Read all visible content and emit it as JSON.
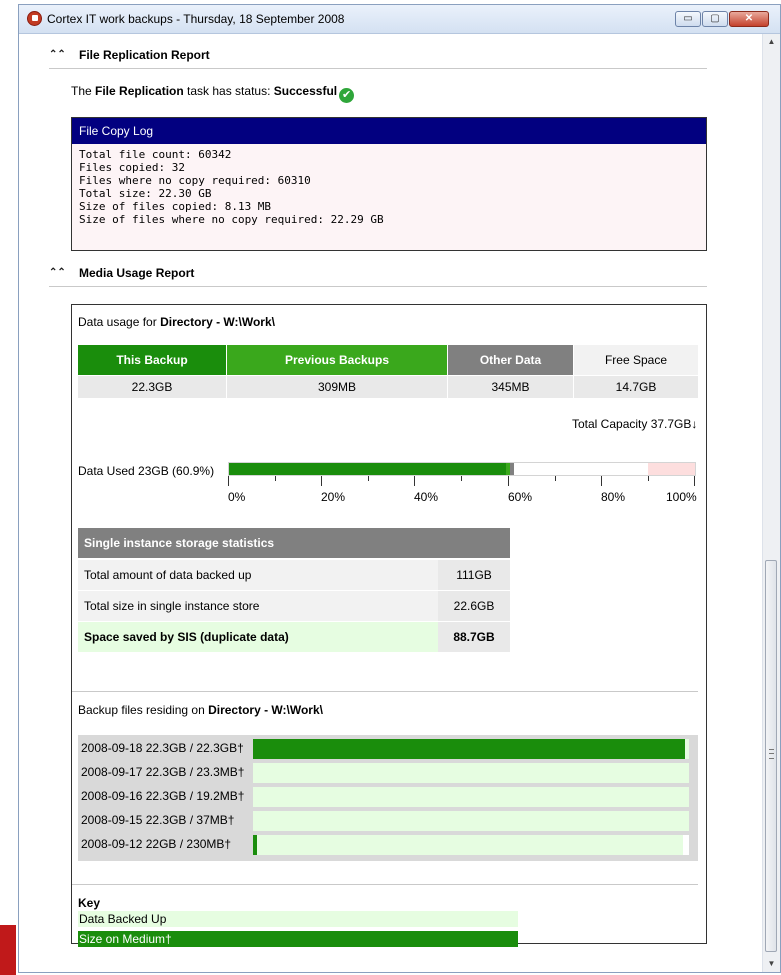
{
  "window": {
    "title": "Cortex IT work backups - Thursday, 18 September 2008",
    "icon": "cortex-app-icon",
    "buttons": {
      "minimize": "▭",
      "maximize": "▢",
      "close": "✕"
    }
  },
  "file_replication": {
    "section_title": "File Replication Report",
    "status_prefix": "The ",
    "task_name": "File Replication",
    "status_middle": " task has status: ",
    "status_value": "Successful",
    "log_title": "File Copy Log",
    "log_lines": [
      "Total file count: 60342",
      "Files copied: 32",
      "Files where no copy required: 60310",
      "Total size: 22.30 GB",
      "Size of files copied: 8.13 MB",
      "Size of files where no copy required: 22.29 GB"
    ]
  },
  "media_usage": {
    "section_title": "Media Usage Report",
    "data_usage_prefix": "Data usage for ",
    "directory_label": "Directory - W:\\Work\\",
    "usage_headers": [
      "This Backup",
      "Previous Backups",
      "Other Data",
      "Free Space"
    ],
    "usage_values": [
      "22.3GB",
      "309MB",
      "345MB",
      "14.7GB"
    ],
    "usage_colors": [
      "#1a8d0c",
      "#3aa81c",
      "#808080",
      "#f2f2f2"
    ],
    "total_capacity": "Total Capacity 37.7GB↓",
    "data_used_label": "Data Used 23GB (60.9%)",
    "bar_segments": [
      {
        "color": "#1a8d0c",
        "fraction": 0.592
      },
      {
        "color": "#3aa81c",
        "fraction": 0.008
      },
      {
        "color": "#808080",
        "fraction": 0.009
      }
    ],
    "free_space_alert": {
      "color": "#fddede",
      "fraction": 0.1
    },
    "axis_labels": [
      "0%",
      "20%",
      "40%",
      "60%",
      "80%",
      "100%"
    ],
    "sis": {
      "title": "Single instance storage statistics",
      "rows": [
        {
          "label": "Total amount of data backed up",
          "value": "111GB"
        },
        {
          "label": "Total size in single instance store",
          "value": "22.6GB"
        },
        {
          "label": "Space saved by SIS (duplicate data)",
          "value": "88.7GB"
        }
      ]
    },
    "backup_files_prefix": "Backup files residing on ",
    "backup_files": [
      {
        "label": "2008-09-18 22.3GB / 22.3GB†",
        "backed_up_fraction": 1.0,
        "medium_fraction": 0.99
      },
      {
        "label": "2008-09-17 22.3GB / 23.3MB†",
        "backed_up_fraction": 1.0,
        "medium_fraction": 0.0
      },
      {
        "label": "2008-09-16 22.3GB / 19.2MB†",
        "backed_up_fraction": 1.0,
        "medium_fraction": 0.0
      },
      {
        "label": "2008-09-15 22.3GB / 37MB†",
        "backed_up_fraction": 1.0,
        "medium_fraction": 0.0
      },
      {
        "label": "2008-09-12 22GB / 230MB†",
        "backed_up_fraction": 0.986,
        "medium_fraction": 0.01
      }
    ],
    "key": {
      "title": "Key",
      "items": [
        {
          "label": "Data Backed Up",
          "color": "#e6fde1",
          "text_color": "#000000"
        },
        {
          "label": "Size on Medium†",
          "color": "#1a8d0c",
          "text_color": "#ffffff"
        }
      ]
    }
  }
}
